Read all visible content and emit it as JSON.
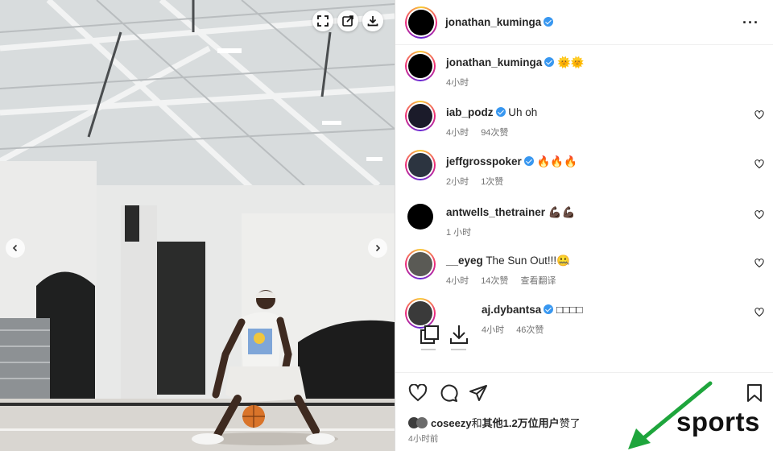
{
  "post": {
    "author": "jonathan_kuminga"
  },
  "photo_overlay": {
    "icons": [
      "fullscreen-icon",
      "open-new-icon",
      "download-icon"
    ],
    "prev": "chevron-left-icon",
    "next": "chevron-right-icon"
  },
  "caption": {
    "user": "jonathan_kuminga",
    "text": "🌞🌞",
    "time": "4小时"
  },
  "comments": [
    {
      "user": "iab_podz",
      "verified": true,
      "text": "Uh oh",
      "time": "4小时",
      "likes": "94次赞",
      "extra": ""
    },
    {
      "user": "jeffgrosspoker",
      "verified": true,
      "text": "🔥🔥🔥",
      "time": "2小时",
      "likes": "1次赞",
      "extra": ""
    },
    {
      "user": "antwells_thetrainer",
      "verified": false,
      "text": "💪🏿💪🏿",
      "time": "1 小时",
      "likes": "",
      "extra": ""
    },
    {
      "user": "__eyeg",
      "verified": false,
      "text": "The Sun Out!!!🤐",
      "time": "4小时",
      "likes": "14次赞",
      "extra": "查看翻译"
    },
    {
      "user": "aj.dybantsa",
      "verified": true,
      "text": "□□□□",
      "time": "4小时",
      "likes": "46次赞",
      "extra": ""
    }
  ],
  "actions": {
    "icons": [
      "heart-icon",
      "comment-icon",
      "share-icon",
      "bookmark-icon"
    ]
  },
  "likes": {
    "user": "coseezy",
    "connector": "和",
    "others": "其他1.2万位用户",
    "suffix": "赞了"
  },
  "post_time": "4小时前",
  "watermark": "sports",
  "colors": {
    "accent_blue": "#3897f0",
    "annotation_arrow": "#1ea53c",
    "story_ring": "#ee2a7b"
  }
}
